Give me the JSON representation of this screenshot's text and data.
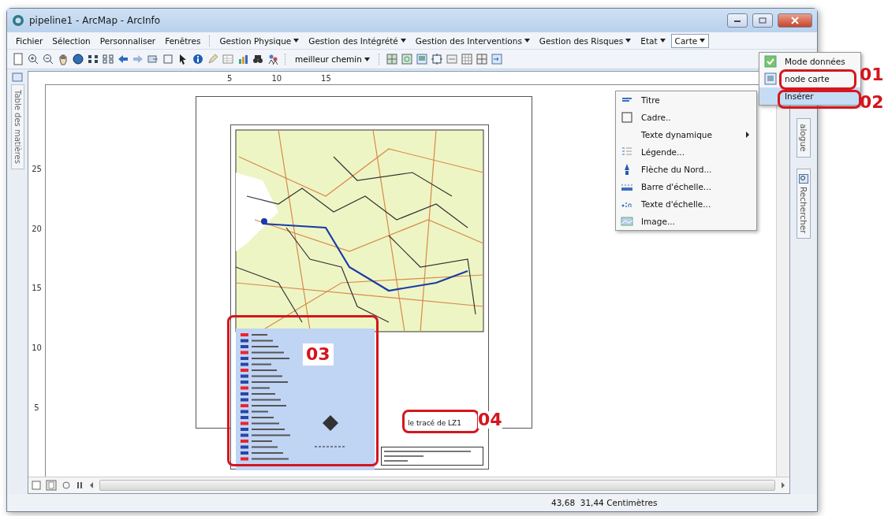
{
  "window": {
    "title": "pipeline1 - ArcMap - ArcInfo"
  },
  "menu_bar": [
    {
      "label": "Fichier",
      "dropdown": false,
      "selected": false
    },
    {
      "label": "Sélection",
      "dropdown": false,
      "selected": false
    },
    {
      "label": "Personnaliser",
      "dropdown": false,
      "selected": false
    },
    {
      "label": "Fenêtres",
      "dropdown": false,
      "selected": false
    },
    {
      "label": "Gestion Physique",
      "dropdown": true,
      "selected": false
    },
    {
      "label": "Gestion des Intégrété",
      "dropdown": true,
      "selected": false
    },
    {
      "label": "Gestion des Interventions",
      "dropdown": true,
      "selected": false
    },
    {
      "label": "Gestion des Risques",
      "dropdown": true,
      "selected": false
    },
    {
      "label": "Etat",
      "dropdown": true,
      "selected": false
    },
    {
      "label": "Carte",
      "dropdown": true,
      "selected": true
    }
  ],
  "toolbar": {
    "dropdown_label": "meilleur chemin"
  },
  "left_tabs": [
    "Table des matières"
  ],
  "right_tabs": [
    {
      "label": "alogue",
      "kind": "plain"
    },
    {
      "label": "Rechercher",
      "kind": "search"
    }
  ],
  "rulers": {
    "horizontal": [
      "5",
      "10",
      "15"
    ],
    "vertical": [
      "25",
      "20",
      "15",
      "10",
      "5"
    ]
  },
  "layout": {
    "map_title": "le tracé de LZ1"
  },
  "carte_menu": [
    {
      "label": "Mode données",
      "kind": "data",
      "selected": false
    },
    {
      "label": "node carte",
      "kind": "layout",
      "selected": false
    },
    {
      "label": "Insérer",
      "kind": "plain",
      "selected": true
    }
  ],
  "insert_submenu": [
    {
      "label": "Titre",
      "kind": "title",
      "submenu": false
    },
    {
      "label": "Cadre..",
      "kind": "frame",
      "submenu": false
    },
    {
      "label": "Texte dynamique",
      "kind": "none",
      "submenu": true
    },
    {
      "label": "Légende...",
      "kind": "legend",
      "submenu": false
    },
    {
      "label": "Flèche du Nord...",
      "kind": "north",
      "submenu": false
    },
    {
      "label": "Barre d'échelle...",
      "kind": "scalebar",
      "submenu": false
    },
    {
      "label": "Texte d'échelle...",
      "kind": "scaletext",
      "submenu": false
    },
    {
      "label": "Image...",
      "kind": "image",
      "submenu": false
    }
  ],
  "annotations": [
    {
      "label": "01"
    },
    {
      "label": "02"
    },
    {
      "label": "03"
    },
    {
      "label": "04"
    }
  ],
  "status_bar": {
    "coordinates": "43,68  31,44 Centimètres"
  }
}
